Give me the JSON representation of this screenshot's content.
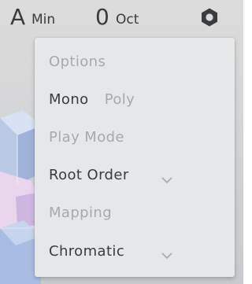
{
  "header": {
    "key_root": "A",
    "key_scale": "Min",
    "octave_value": "0",
    "octave_label": "Oct"
  },
  "icons": {
    "settings": "gear-icon",
    "dropdown": "chevron-down-icon"
  },
  "menu": {
    "options_header": "Options",
    "voice_mode": {
      "selected": "Mono",
      "other": "Poly"
    },
    "play_mode_header": "Play Mode",
    "play_mode_value": "Root Order",
    "mapping_header": "Mapping",
    "mapping_value": "Chromatic"
  },
  "colors": {
    "text_dark": "#3a3b3e",
    "text_muted": "#a8a9ac",
    "menu_bg": "#e6e7e9",
    "app_bg": "#d4d5d7"
  }
}
